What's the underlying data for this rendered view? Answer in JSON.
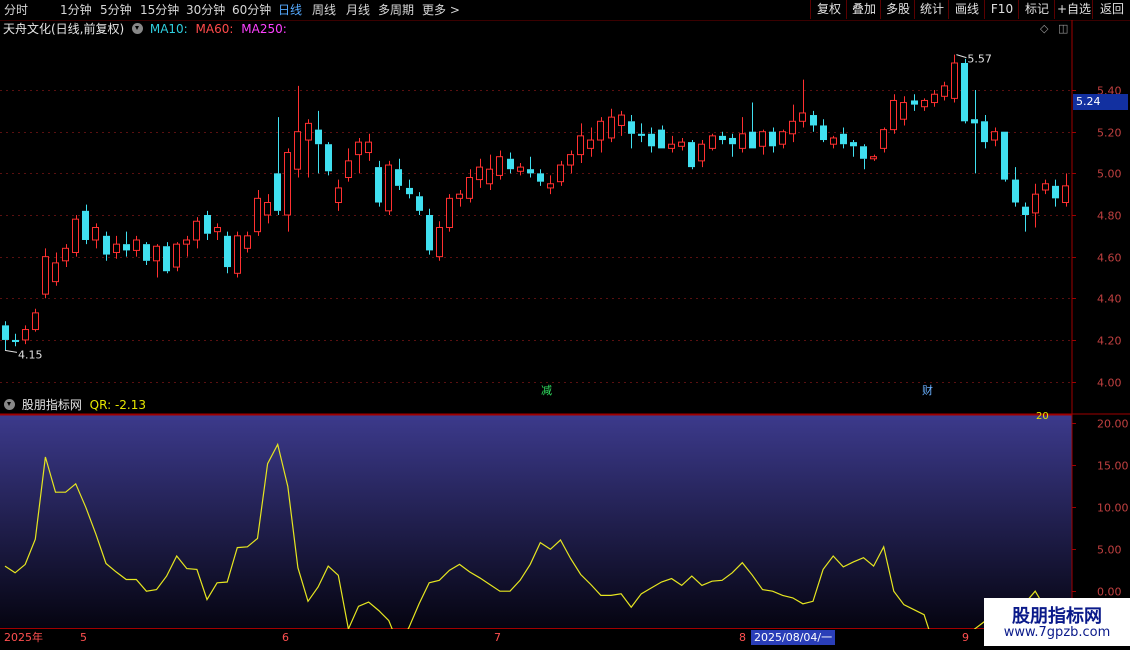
{
  "toolbar": {
    "tabs": [
      "分时",
      "1分钟",
      "5分钟",
      "15分钟",
      "30分钟",
      "60分钟",
      "日线",
      "周线",
      "月线",
      "多周期",
      "更多 >"
    ],
    "selected": "日线",
    "buttons": [
      "复权",
      "叠加",
      "多股",
      "统计",
      "画线",
      "F10",
      "标记",
      "+自选",
      "返回"
    ]
  },
  "header": {
    "stock": "天舟文化(日线,前复权)",
    "ma10": "MA10:",
    "ma60": "MA60:",
    "ma250": "MA250:"
  },
  "price_axis": {
    "ticks": [
      "5.40",
      "5.20",
      "5.00",
      "4.80",
      "4.60",
      "4.40",
      "4.20",
      "4.00"
    ],
    "current_price": "5.24",
    "high_label": "5.57",
    "low_label": "4.15"
  },
  "markers": {
    "m1": "减",
    "m2": "财"
  },
  "indicator": {
    "name": "股朋指标网",
    "qr_label": "QR: -2.13",
    "ticks": [
      "20.00",
      "15.00",
      "10.00",
      "5.00",
      "0.00"
    ],
    "level_label": "20"
  },
  "dates": {
    "year": "2025年",
    "m5": "5",
    "m6": "6",
    "m7": "7",
    "m8": "8",
    "m9": "9",
    "selected": "2025/08/04/一"
  },
  "watermark": {
    "cn": "股朋指标网",
    "url": "www.7gpzb.com"
  },
  "colors": {
    "up": "#ff3030",
    "down": "#40e0f0",
    "line": "#e6e620",
    "axis": "#a00000",
    "current_bg": "#1230a0"
  },
  "chart_data": {
    "type": "candlestick",
    "price_ylim": [
      3.95,
      5.65
    ],
    "candles": [
      {
        "o": 4.27,
        "h": 4.29,
        "l": 4.15,
        "c": 4.2
      },
      {
        "o": 4.2,
        "h": 4.23,
        "l": 4.17,
        "c": 4.19
      },
      {
        "o": 4.2,
        "h": 4.27,
        "l": 4.18,
        "c": 4.25
      },
      {
        "o": 4.25,
        "h": 4.35,
        "l": 4.24,
        "c": 4.33
      },
      {
        "o": 4.42,
        "h": 4.64,
        "l": 4.4,
        "c": 4.6
      },
      {
        "o": 4.48,
        "h": 4.62,
        "l": 4.46,
        "c": 4.57
      },
      {
        "o": 4.58,
        "h": 4.66,
        "l": 4.55,
        "c": 4.64
      },
      {
        "o": 4.62,
        "h": 4.8,
        "l": 4.6,
        "c": 4.78
      },
      {
        "o": 4.82,
        "h": 4.85,
        "l": 4.66,
        "c": 4.68
      },
      {
        "o": 4.68,
        "h": 4.76,
        "l": 4.64,
        "c": 4.74
      },
      {
        "o": 4.7,
        "h": 4.72,
        "l": 4.58,
        "c": 4.61
      },
      {
        "o": 4.62,
        "h": 4.7,
        "l": 4.59,
        "c": 4.66
      },
      {
        "o": 4.66,
        "h": 4.72,
        "l": 4.6,
        "c": 4.63
      },
      {
        "o": 4.63,
        "h": 4.7,
        "l": 4.6,
        "c": 4.68
      },
      {
        "o": 4.66,
        "h": 4.67,
        "l": 4.56,
        "c": 4.58
      },
      {
        "o": 4.58,
        "h": 4.66,
        "l": 4.5,
        "c": 4.65
      },
      {
        "o": 4.65,
        "h": 4.67,
        "l": 4.52,
        "c": 4.53
      },
      {
        "o": 4.55,
        "h": 4.67,
        "l": 4.53,
        "c": 4.66
      },
      {
        "o": 4.66,
        "h": 4.7,
        "l": 4.6,
        "c": 4.68
      },
      {
        "o": 4.68,
        "h": 4.79,
        "l": 4.64,
        "c": 4.77
      },
      {
        "o": 4.8,
        "h": 4.82,
        "l": 4.68,
        "c": 4.71
      },
      {
        "o": 4.72,
        "h": 4.76,
        "l": 4.68,
        "c": 4.74
      },
      {
        "o": 4.7,
        "h": 4.72,
        "l": 4.52,
        "c": 4.55
      },
      {
        "o": 4.52,
        "h": 4.72,
        "l": 4.5,
        "c": 4.7
      },
      {
        "o": 4.64,
        "h": 4.72,
        "l": 4.62,
        "c": 4.7
      },
      {
        "o": 4.72,
        "h": 4.92,
        "l": 4.7,
        "c": 4.88
      },
      {
        "o": 4.8,
        "h": 4.9,
        "l": 4.76,
        "c": 4.86
      },
      {
        "o": 5.0,
        "h": 5.27,
        "l": 4.8,
        "c": 4.82
      },
      {
        "o": 4.8,
        "h": 5.12,
        "l": 4.72,
        "c": 5.1
      },
      {
        "o": 5.02,
        "h": 5.42,
        "l": 4.98,
        "c": 5.2
      },
      {
        "o": 5.16,
        "h": 5.26,
        "l": 4.98,
        "c": 5.24
      },
      {
        "o": 5.21,
        "h": 5.3,
        "l": 5.0,
        "c": 5.14
      },
      {
        "o": 5.14,
        "h": 5.15,
        "l": 4.99,
        "c": 5.01
      },
      {
        "o": 4.86,
        "h": 4.97,
        "l": 4.82,
        "c": 4.93
      },
      {
        "o": 4.98,
        "h": 5.12,
        "l": 4.96,
        "c": 5.06
      },
      {
        "o": 5.09,
        "h": 5.17,
        "l": 5.0,
        "c": 5.15
      },
      {
        "o": 5.1,
        "h": 5.19,
        "l": 5.06,
        "c": 5.15
      },
      {
        "o": 5.03,
        "h": 5.06,
        "l": 4.84,
        "c": 4.86
      },
      {
        "o": 4.82,
        "h": 5.06,
        "l": 4.8,
        "c": 5.04
      },
      {
        "o": 5.02,
        "h": 5.07,
        "l": 4.92,
        "c": 4.94
      },
      {
        "o": 4.93,
        "h": 4.97,
        "l": 4.88,
        "c": 4.9
      },
      {
        "o": 4.89,
        "h": 4.91,
        "l": 4.8,
        "c": 4.82
      },
      {
        "o": 4.8,
        "h": 4.83,
        "l": 4.61,
        "c": 4.63
      },
      {
        "o": 4.6,
        "h": 4.77,
        "l": 4.58,
        "c": 4.74
      },
      {
        "o": 4.74,
        "h": 4.9,
        "l": 4.72,
        "c": 4.88
      },
      {
        "o": 4.88,
        "h": 4.92,
        "l": 4.84,
        "c": 4.9
      },
      {
        "o": 4.88,
        "h": 5.02,
        "l": 4.86,
        "c": 4.98
      },
      {
        "o": 4.97,
        "h": 5.07,
        "l": 4.93,
        "c": 5.03
      },
      {
        "o": 4.95,
        "h": 5.09,
        "l": 4.92,
        "c": 5.02
      },
      {
        "o": 4.99,
        "h": 5.11,
        "l": 4.97,
        "c": 5.08
      },
      {
        "o": 5.07,
        "h": 5.1,
        "l": 5.0,
        "c": 5.02
      },
      {
        "o": 5.01,
        "h": 5.05,
        "l": 4.99,
        "c": 5.03
      },
      {
        "o": 5.02,
        "h": 5.08,
        "l": 4.98,
        "c": 5.0
      },
      {
        "o": 5.0,
        "h": 5.02,
        "l": 4.94,
        "c": 4.96
      },
      {
        "o": 4.93,
        "h": 4.99,
        "l": 4.9,
        "c": 4.95
      },
      {
        "o": 4.96,
        "h": 5.06,
        "l": 4.94,
        "c": 5.04
      },
      {
        "o": 5.04,
        "h": 5.11,
        "l": 5.0,
        "c": 5.09
      },
      {
        "o": 5.09,
        "h": 5.24,
        "l": 5.05,
        "c": 5.18
      },
      {
        "o": 5.12,
        "h": 5.22,
        "l": 5.08,
        "c": 5.16
      },
      {
        "o": 5.16,
        "h": 5.27,
        "l": 5.1,
        "c": 5.25
      },
      {
        "o": 5.17,
        "h": 5.31,
        "l": 5.15,
        "c": 5.27
      },
      {
        "o": 5.23,
        "h": 5.3,
        "l": 5.18,
        "c": 5.28
      },
      {
        "o": 5.25,
        "h": 5.28,
        "l": 5.12,
        "c": 5.19
      },
      {
        "o": 5.19,
        "h": 5.24,
        "l": 5.15,
        "c": 5.18
      },
      {
        "o": 5.19,
        "h": 5.22,
        "l": 5.1,
        "c": 5.13
      },
      {
        "o": 5.21,
        "h": 5.23,
        "l": 5.12,
        "c": 5.12
      },
      {
        "o": 5.12,
        "h": 5.18,
        "l": 5.1,
        "c": 5.14
      },
      {
        "o": 5.13,
        "h": 5.17,
        "l": 5.11,
        "c": 5.15
      },
      {
        "o": 5.15,
        "h": 5.16,
        "l": 5.02,
        "c": 5.03
      },
      {
        "o": 5.06,
        "h": 5.16,
        "l": 5.03,
        "c": 5.14
      },
      {
        "o": 5.12,
        "h": 5.19,
        "l": 5.11,
        "c": 5.18
      },
      {
        "o": 5.18,
        "h": 5.2,
        "l": 5.14,
        "c": 5.16
      },
      {
        "o": 5.17,
        "h": 5.19,
        "l": 5.08,
        "c": 5.14
      },
      {
        "o": 5.12,
        "h": 5.27,
        "l": 5.1,
        "c": 5.19
      },
      {
        "o": 5.2,
        "h": 5.34,
        "l": 5.12,
        "c": 5.12
      },
      {
        "o": 5.13,
        "h": 5.21,
        "l": 5.09,
        "c": 5.2
      },
      {
        "o": 5.2,
        "h": 5.22,
        "l": 5.1,
        "c": 5.13
      },
      {
        "o": 5.14,
        "h": 5.21,
        "l": 5.12,
        "c": 5.2
      },
      {
        "o": 5.19,
        "h": 5.33,
        "l": 5.15,
        "c": 5.25
      },
      {
        "o": 5.25,
        "h": 5.45,
        "l": 5.22,
        "c": 5.29
      },
      {
        "o": 5.28,
        "h": 5.3,
        "l": 5.2,
        "c": 5.23
      },
      {
        "o": 5.23,
        "h": 5.26,
        "l": 5.15,
        "c": 5.16
      },
      {
        "o": 5.14,
        "h": 5.18,
        "l": 5.12,
        "c": 5.17
      },
      {
        "o": 5.19,
        "h": 5.22,
        "l": 5.12,
        "c": 5.14
      },
      {
        "o": 5.15,
        "h": 5.16,
        "l": 5.08,
        "c": 5.13
      },
      {
        "o": 5.13,
        "h": 5.14,
        "l": 5.02,
        "c": 5.07
      },
      {
        "o": 5.07,
        "h": 5.09,
        "l": 5.06,
        "c": 5.08
      },
      {
        "o": 5.12,
        "h": 5.22,
        "l": 5.1,
        "c": 5.21
      },
      {
        "o": 5.21,
        "h": 5.38,
        "l": 5.19,
        "c": 5.35
      },
      {
        "o": 5.26,
        "h": 5.37,
        "l": 5.23,
        "c": 5.34
      },
      {
        "o": 5.35,
        "h": 5.38,
        "l": 5.3,
        "c": 5.33
      },
      {
        "o": 5.32,
        "h": 5.36,
        "l": 5.3,
        "c": 5.35
      },
      {
        "o": 5.34,
        "h": 5.4,
        "l": 5.32,
        "c": 5.38
      },
      {
        "o": 5.37,
        "h": 5.44,
        "l": 5.35,
        "c": 5.42
      },
      {
        "o": 5.36,
        "h": 5.57,
        "l": 5.34,
        "c": 5.53
      },
      {
        "o": 5.53,
        "h": 5.55,
        "l": 5.24,
        "c": 5.25
      },
      {
        "o": 5.26,
        "h": 5.4,
        "l": 5.0,
        "c": 5.24
      },
      {
        "o": 5.25,
        "h": 5.28,
        "l": 5.12,
        "c": 5.15
      },
      {
        "o": 5.16,
        "h": 5.22,
        "l": 5.13,
        "c": 5.2
      },
      {
        "o": 5.2,
        "h": 5.2,
        "l": 4.96,
        "c": 4.97
      },
      {
        "o": 4.97,
        "h": 5.03,
        "l": 4.84,
        "c": 4.86
      },
      {
        "o": 4.84,
        "h": 4.86,
        "l": 4.72,
        "c": 4.8
      },
      {
        "o": 4.81,
        "h": 4.95,
        "l": 4.74,
        "c": 4.9
      },
      {
        "o": 4.92,
        "h": 4.97,
        "l": 4.9,
        "c": 4.95
      },
      {
        "o": 4.94,
        "h": 4.97,
        "l": 4.84,
        "c": 4.88
      },
      {
        "o": 4.86,
        "h": 5.0,
        "l": 4.84,
        "c": 4.94
      }
    ],
    "indicator_ylim": [
      -4.5,
      21
    ],
    "indicator_values": [
      3,
      2.2,
      3.2,
      6.2,
      16,
      11.8,
      11.8,
      12.8,
      10,
      6.8,
      3.3,
      2.3,
      1.4,
      1.4,
      0,
      0.2,
      1.8,
      4.2,
      2.7,
      2.6,
      -1,
      1,
      1.1,
      5.2,
      5.3,
      6.3,
      15.2,
      17.5,
      12.5,
      2.8,
      -1.2,
      0.5,
      3,
      1.9,
      -4.5,
      -1.8,
      -1.3,
      -2.3,
      -3.5,
      -6.5,
      -4.3,
      -1.5,
      1,
      1.3,
      2.5,
      3.2,
      2.3,
      1.6,
      0.8,
      0,
      0,
      1.3,
      3.2,
      5.8,
      5,
      6.1,
      3.9,
      2,
      0.8,
      -0.5,
      -0.5,
      -0.3,
      -1.9,
      -0.3,
      0.4,
      1.1,
      1.5,
      0.7,
      1.8,
      0.7,
      1.2,
      1.3,
      2.2,
      3.4,
      1.9,
      0.2,
      0,
      -0.5,
      -0.8,
      -1.5,
      -1.2,
      2.6,
      4.2,
      2.9,
      3.5,
      4,
      3,
      5.3,
      0,
      -1.6,
      -2.2,
      -2.8,
      -6.5,
      -8.7,
      -9.2,
      -6.5,
      -4.5,
      -3.6,
      -3.6,
      -2.2,
      -2.2,
      -1.4,
      0,
      -2
    ]
  }
}
